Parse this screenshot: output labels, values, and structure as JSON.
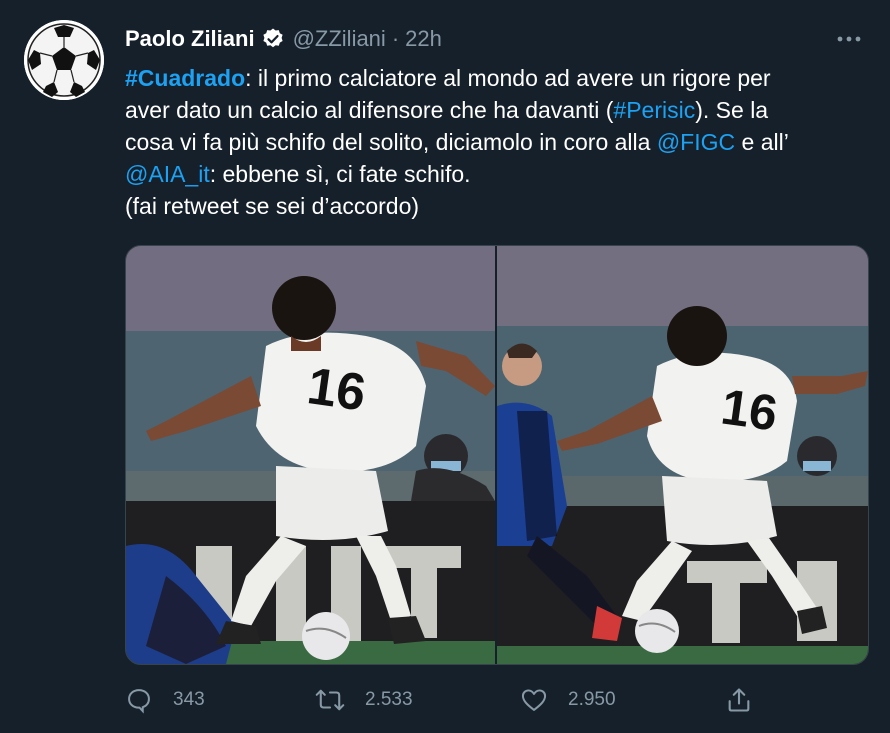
{
  "author": {
    "name": "Paolo Ziliani",
    "handle": "@ZZiliani",
    "separator": "·",
    "time": "22h",
    "verified": true,
    "avatar_icon": "soccer-ball-icon"
  },
  "more_icon": "more-options-icon",
  "tweet": {
    "line1_tag": "#Cuadrado",
    "line1_rest": ": il primo calciatore al mondo ad avere un rigore per",
    "line2_a": "aver dato un calcio al difensore che ha davanti (",
    "line2_tag": "#Perisic",
    "line2_b": "). Se la",
    "line3_a": "cosa vi fa più schifo del solito, diciamolo in coro alla ",
    "line3_mention": "@FIGC",
    "line3_b": " e all’",
    "line4_mention": "@AIA_it",
    "line4_rest": ": ebbene sì, ci fate schifo.",
    "line5": "(fai retweet se sei d’accordo)"
  },
  "colors": {
    "background": "#15202b",
    "link": "#1da1f2",
    "secondary": "#8899a6",
    "border": "#38444d"
  },
  "actions": {
    "reply_count": "343",
    "retweet_count": "2.533",
    "like_count": "2.950"
  }
}
